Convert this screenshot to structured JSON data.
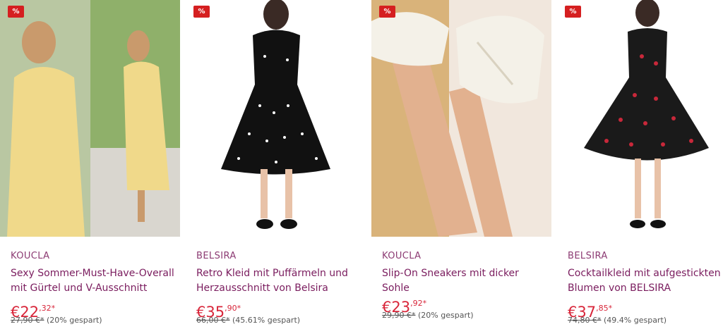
{
  "products": [
    {
      "badge": "%",
      "brand": "KOUCLA",
      "title": "Sexy Sommer-Must-Have-Overall mit Gürtel und V-Ausschnitt",
      "price_main": "€22",
      "price_cents": ",32*",
      "old_price": "27,90 €*",
      "saving": "(20% gespart)"
    },
    {
      "badge": "%",
      "brand": "BELSIRA",
      "title": "Retro Kleid mit Puffärmeln und Herzausschnitt von Belsira",
      "price_main": "€35",
      "price_cents": ",90*",
      "old_price": "66,00 €*",
      "saving": "(45.61% gespart)"
    },
    {
      "badge": "%",
      "brand": "KOUCLA",
      "title": "Slip-On Sneakers mit dicker Sohle",
      "price_main": "€23",
      "price_cents": ",92*",
      "old_price": "29,90 €*",
      "saving": "(20% gespart)"
    },
    {
      "badge": "%",
      "brand": "BELSIRA",
      "title": "Cocktailkleid mit aufgestickten Blumen von BELSIRA",
      "price_main": "€37",
      "price_cents": ",85*",
      "old_price": "74,80 €*",
      "saving": "(49.4% gespart)"
    }
  ],
  "colors": {
    "badge": "#d51f20",
    "brand": "#8c3b73",
    "title": "#7a1c5e",
    "price": "#d8263a"
  }
}
